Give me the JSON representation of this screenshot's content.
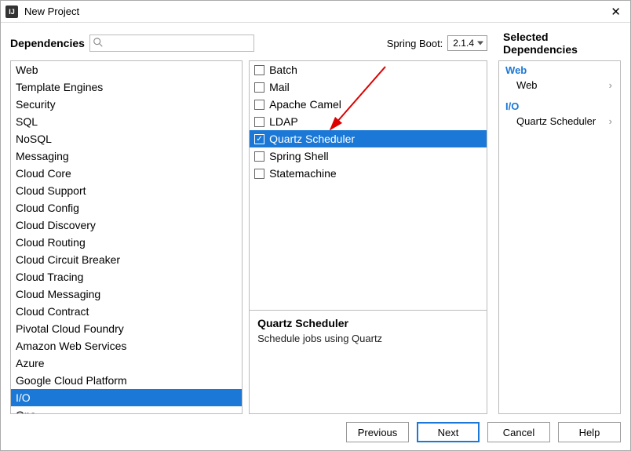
{
  "window": {
    "title": "New Project",
    "icon_text": "IJ"
  },
  "header": {
    "dependencies_label": "Dependencies",
    "search_placeholder": "",
    "spring_boot_label": "Spring Boot:",
    "spring_boot_value": "2.1.4",
    "selected_dependencies_label": "Selected Dependencies"
  },
  "categories": [
    "Web",
    "Template Engines",
    "Security",
    "SQL",
    "NoSQL",
    "Messaging",
    "Cloud Core",
    "Cloud Support",
    "Cloud Config",
    "Cloud Discovery",
    "Cloud Routing",
    "Cloud Circuit Breaker",
    "Cloud Tracing",
    "Cloud Messaging",
    "Cloud Contract",
    "Pivotal Cloud Foundry",
    "Amazon Web Services",
    "Azure",
    "Google Cloud Platform",
    "I/O",
    "Ops"
  ],
  "selected_category_index": 19,
  "options": [
    {
      "label": "Batch",
      "checked": false
    },
    {
      "label": "Mail",
      "checked": false
    },
    {
      "label": "Apache Camel",
      "checked": false
    },
    {
      "label": "LDAP",
      "checked": false
    },
    {
      "label": "Quartz Scheduler",
      "checked": true
    },
    {
      "label": "Spring Shell",
      "checked": false
    },
    {
      "label": "Statemachine",
      "checked": false
    }
  ],
  "selected_option_index": 4,
  "detail": {
    "title": "Quartz Scheduler",
    "description": "Schedule jobs using Quartz"
  },
  "selected_dependencies": [
    {
      "group": "Web",
      "items": [
        "Web"
      ]
    },
    {
      "group": "I/O",
      "items": [
        "Quartz Scheduler"
      ]
    }
  ],
  "buttons": {
    "previous": "Previous",
    "next": "Next",
    "cancel": "Cancel",
    "help": "Help"
  }
}
